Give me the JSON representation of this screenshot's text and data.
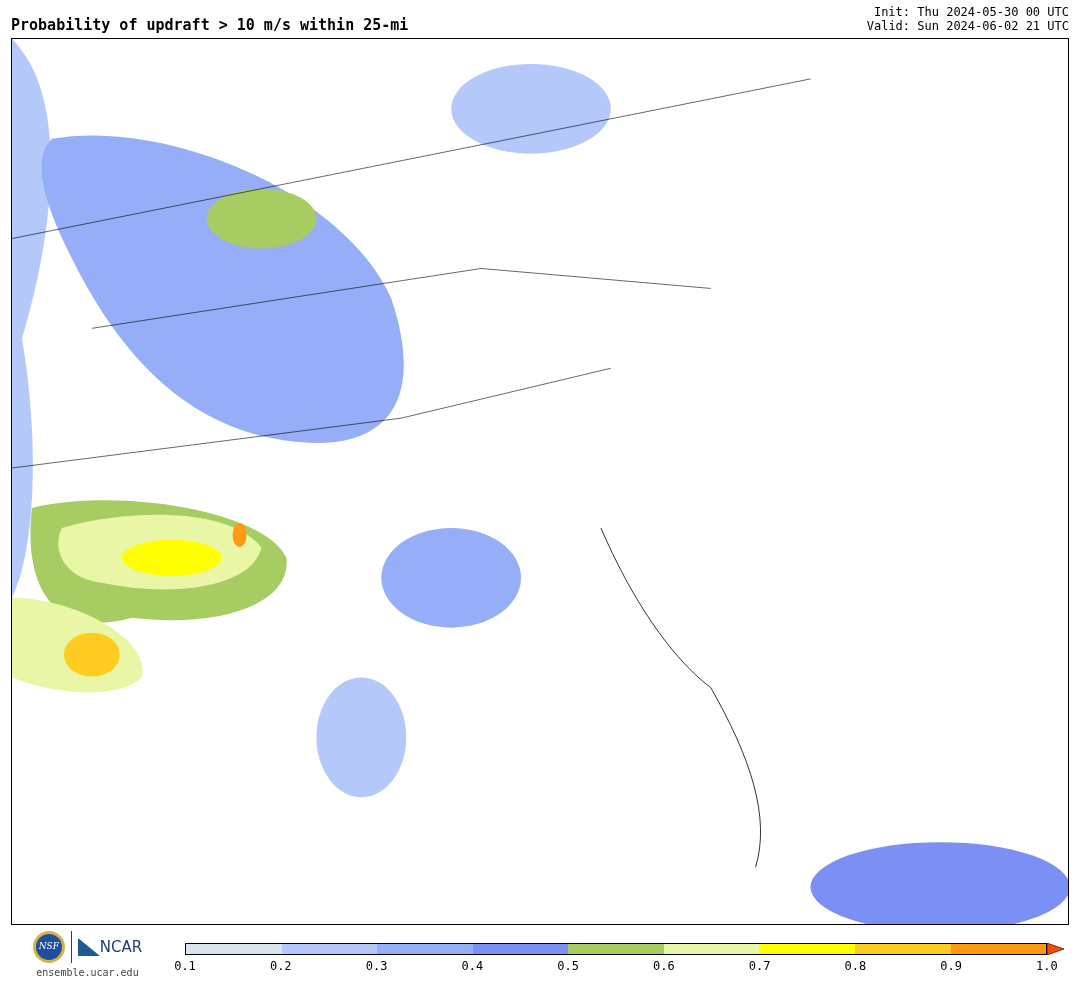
{
  "title": "Probability of updraft > 10 m/s within 25-mi",
  "init": "Init: Thu 2024-05-30 00 UTC",
  "valid": "Valid: Sun 2024-06-02 21 UTC",
  "logos": {
    "nsf": "NSF",
    "ncar": "NCAR",
    "url": "ensemble.ucar.edu"
  },
  "colorbar": {
    "bins": [
      {
        "color": "#dbe4ee"
      },
      {
        "color": "#b4c8fa"
      },
      {
        "color": "#95aef7"
      },
      {
        "color": "#7b8ff4"
      },
      {
        "color": "#a6cc62"
      },
      {
        "color": "#e9f6a6"
      },
      {
        "color": "#ffff00"
      },
      {
        "color": "#ffcc22"
      },
      {
        "color": "#ff9a10"
      }
    ],
    "arrow": {
      "color": "#ff4a00"
    },
    "ticks": [
      "0.1",
      "0.2",
      "0.3",
      "0.4",
      "0.5",
      "0.6",
      "0.7",
      "0.8",
      "0.9",
      "1.0"
    ]
  }
}
